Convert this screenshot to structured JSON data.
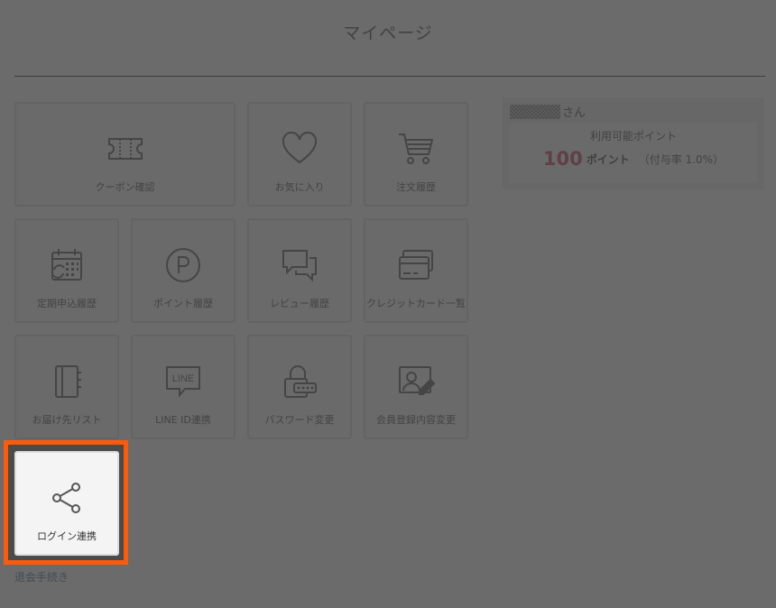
{
  "page": {
    "title": "マイページ"
  },
  "menu": {
    "coupon": "クーポン確認",
    "favorites": "お気に入り",
    "orders": "注文履歴",
    "subscription": "定期申込履歴",
    "points_history": "ポイント履歴",
    "reviews": "レビュー履歴",
    "credit_cards": "クレジットカード一覧",
    "addresses": "お届け先リスト",
    "line": "LINE ID連携",
    "password": "パスワード変更",
    "member_info": "会員登録内容変更",
    "login_link": "ログイン連携"
  },
  "icons": {
    "coupon": "ticket-icon",
    "favorites": "heart-icon",
    "orders": "cart-icon",
    "subscription": "calendar-refresh-icon",
    "points_history": "point-p-icon",
    "reviews": "chat-bubbles-icon",
    "credit_cards": "credit-card-icon",
    "addresses": "address-book-icon",
    "line": "line-icon",
    "password": "lock-icon",
    "member_info": "profile-edit-icon",
    "login_link": "share-icon",
    "line_glyph_text": "LINE"
  },
  "points": {
    "name_suffix": "さん",
    "caption": "利用可能ポイント",
    "value": "100",
    "unit": "ポイント",
    "rate": "（付与率 1.0%）"
  },
  "links": {
    "withdraw": "退会手続き"
  },
  "colors": {
    "highlight": "#ff5a0a",
    "points_value": "#c0284e",
    "link": "#3a5a8c"
  }
}
